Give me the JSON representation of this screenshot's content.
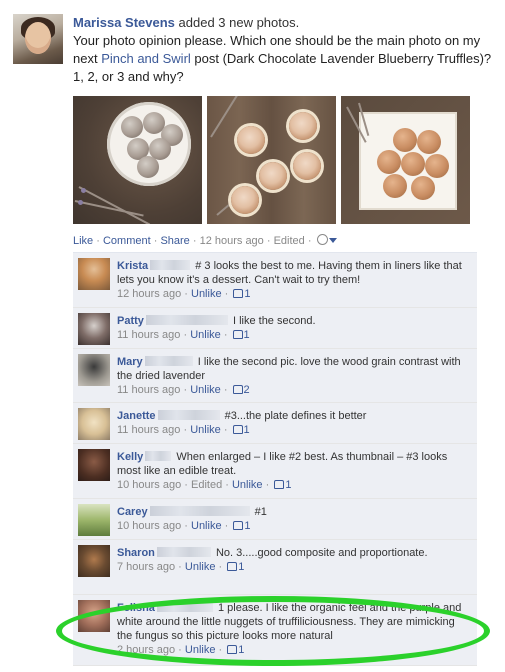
{
  "post": {
    "poster_name": "Marissa Stevens",
    "action_text": " added 3 new photos.",
    "message_before_link": "Your photo opinion please. Which one should be the main photo on my next ",
    "message_link": "Pinch and Swirl",
    "message_after_link": " post (Dark Chocolate Lavender Blueberry Truffles)? 1, 2, or 3 and why?",
    "actions": {
      "like": "Like",
      "comment": "Comment",
      "share": "Share",
      "time": "12 hours ago",
      "edited": "Edited"
    }
  },
  "comments": [
    {
      "name": "Krista",
      "text": " # 3 looks the best to me. Having them in liners like that lets you know it's a dessert. Can't wait to try them!",
      "time": "12 hours ago",
      "edited": "",
      "unlike": "Unlike",
      "likes": "1"
    },
    {
      "name": "Patty",
      "text": " I like the second.",
      "time": "11 hours ago",
      "edited": "",
      "unlike": "Unlike",
      "likes": "1"
    },
    {
      "name": "Mary",
      "text": " I like the second pic. love the wood grain contrast with the dried lavender",
      "time": "11 hours ago",
      "edited": "",
      "unlike": "Unlike",
      "likes": "2"
    },
    {
      "name": "Janette",
      "text": " #3...the plate defines it better",
      "time": "11 hours ago",
      "edited": "",
      "unlike": "Unlike",
      "likes": "1"
    },
    {
      "name": "Kelly",
      "text": " When enlarged – I like #2 best. As thumbnail – #3 looks most like an edible treat.",
      "time": "10 hours ago",
      "edited": "Edited",
      "unlike": "Unlike",
      "likes": "1"
    },
    {
      "name": "Carey",
      "text": " #1",
      "time": "10 hours ago",
      "edited": "",
      "unlike": "Unlike",
      "likes": "1"
    },
    {
      "name": "Sharon",
      "text": " No. 3.....good composite and proportionate.",
      "time": "7 hours ago",
      "edited": "",
      "unlike": "Unlike",
      "likes": "1"
    },
    {
      "name": "Felisha",
      "text": " 1 please. I like the organic feel and the purple and white around the little nuggets of truffiliciousness. They are mimicking the fungus so this picture looks more natural",
      "time": "2 hours ago",
      "edited": "",
      "unlike": "Unlike",
      "likes": "1"
    }
  ],
  "icons": {
    "globe": "globe-icon",
    "audience_caret": "chevron-down-icon",
    "like": "thumbs-up-icon"
  },
  "colors": {
    "link_blue": "#3b5998",
    "comment_bg": "#edeff4",
    "highlight_green": "#2bd12b"
  }
}
